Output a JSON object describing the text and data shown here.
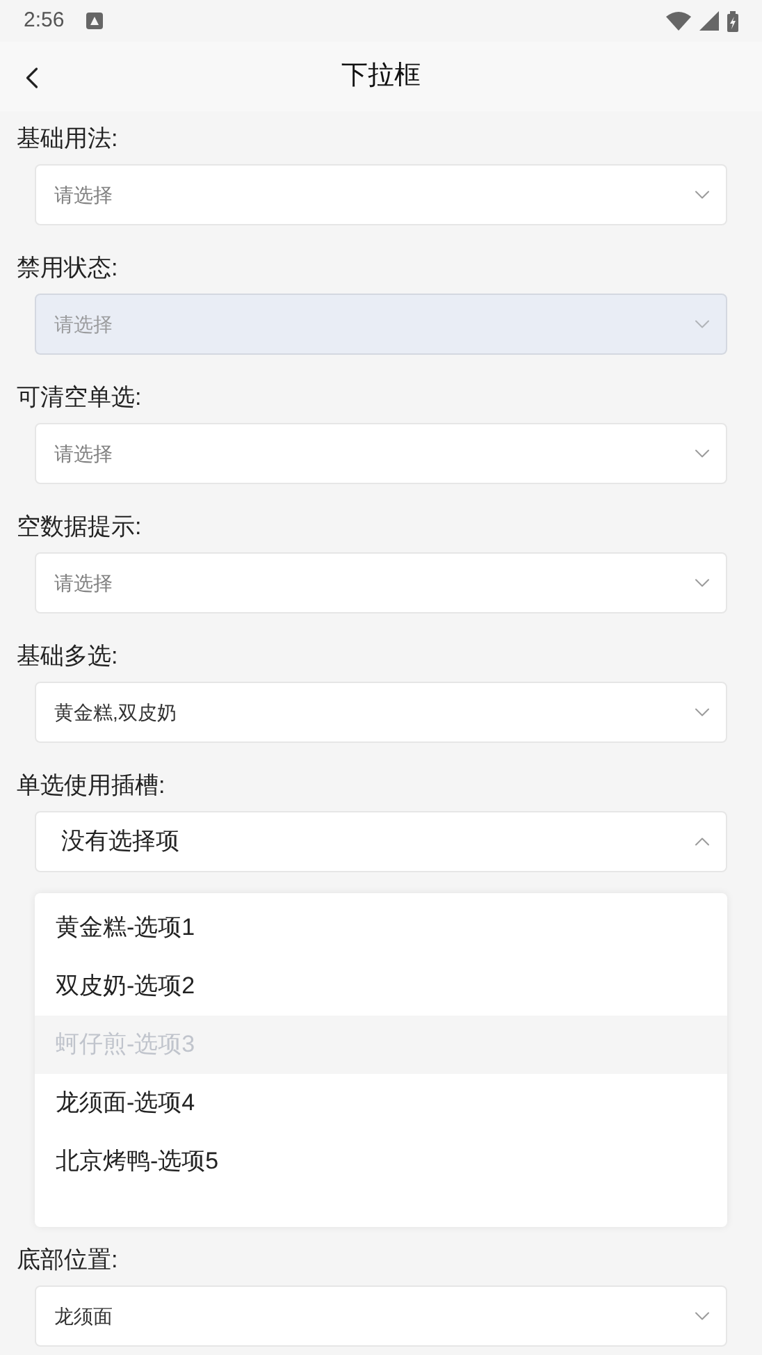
{
  "status_bar": {
    "time": "2:56"
  },
  "header": {
    "title": "下拉框"
  },
  "sections": [
    {
      "label": "基础用法:",
      "field": {
        "kind": "placeholder",
        "text": "请选择",
        "disabled": false,
        "expanded": false
      }
    },
    {
      "label": "禁用状态:",
      "field": {
        "kind": "placeholder",
        "text": "请选择",
        "disabled": true,
        "expanded": false
      }
    },
    {
      "label": "可清空单选:",
      "field": {
        "kind": "placeholder",
        "text": "请选择",
        "disabled": false,
        "expanded": false
      }
    },
    {
      "label": "空数据提示:",
      "field": {
        "kind": "placeholder",
        "text": "请选择",
        "disabled": false,
        "expanded": false
      }
    },
    {
      "label": "基础多选:",
      "field": {
        "kind": "value",
        "text": "黄金糕,双皮奶",
        "disabled": false,
        "expanded": false
      }
    },
    {
      "label": "单选使用插槽:",
      "field": {
        "kind": "slot",
        "text": "没有选择项",
        "disabled": false,
        "expanded": true,
        "options": [
          {
            "label": "黄金糕-选项1",
            "disabled": false
          },
          {
            "label": "双皮奶-选项2",
            "disabled": false
          },
          {
            "label": "蚵仔煎-选项3",
            "disabled": true
          },
          {
            "label": "龙须面-选项4",
            "disabled": false
          },
          {
            "label": "北京烤鸭-选项5",
            "disabled": false
          }
        ]
      }
    },
    {
      "label": "底部位置:",
      "field": {
        "kind": "value",
        "text": "龙须面",
        "disabled": false,
        "expanded": false
      }
    }
  ]
}
